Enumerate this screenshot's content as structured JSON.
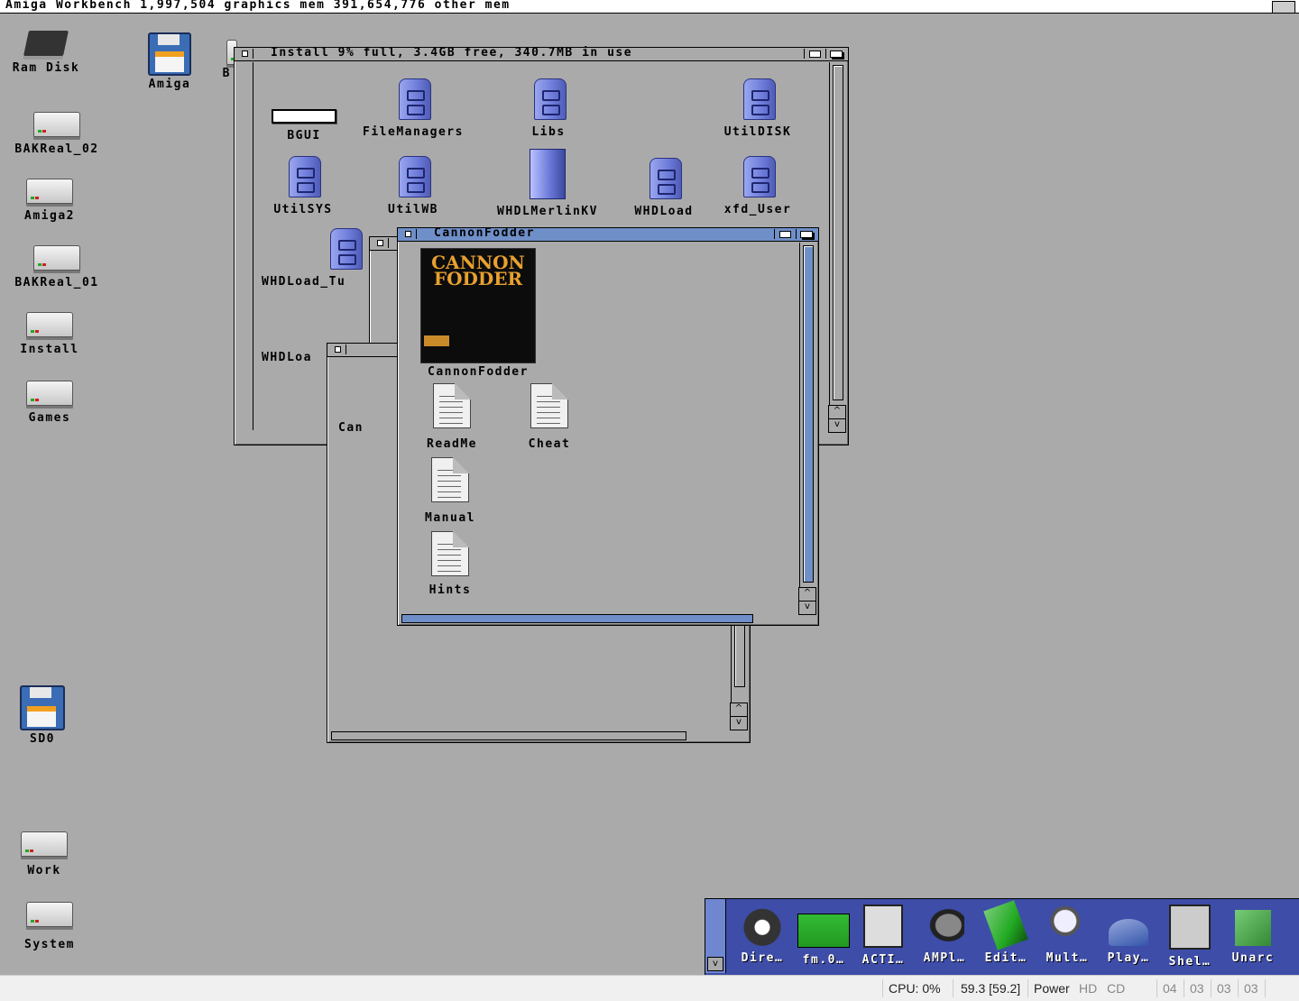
{
  "screen": {
    "title": "Amiga Workbench  1,997,504 graphics mem  391,654,776 other mem"
  },
  "desktop_icons": {
    "ram_disk": "Ram Disk",
    "amiga": "Amiga",
    "b_partial": "B",
    "bakreal02": "BAKReal_02",
    "amiga2": "Amiga2",
    "bakreal01": "BAKReal_01",
    "install": "Install",
    "games": "Games",
    "sd0": "SD0",
    "work": "Work",
    "system": "System"
  },
  "install_window": {
    "title": "Install   9% full, 3.4GB free, 340.7MB in use",
    "icons": {
      "bgui": "BGUI",
      "filemanagers": "FileManagers",
      "libs": "Libs",
      "utildisk": "UtilDISK",
      "utilsys": "UtilSYS",
      "utilwb": "UtilWB",
      "whdlmerlinkv": "WHDLMerlinKV",
      "whdload": "WHDLoad",
      "xfd_user": "xfd_User",
      "whdload_tu": "WHDLoad_Tu",
      "whdloa": "WHDLoa"
    }
  },
  "back_window": {
    "label_partial": "Can"
  },
  "cannon_window": {
    "title": "CannonFodder",
    "cover_line1": "CANNON",
    "cover_line2": "FODDER",
    "icons": {
      "game": "CannonFodder",
      "readme": "ReadMe",
      "cheat": "Cheat",
      "manual": "Manual",
      "hints": "Hints"
    }
  },
  "dock": {
    "items": [
      "Dire…",
      "fm.0…",
      "ACTI…",
      "AMPl…",
      "Edit…",
      "Mult…",
      "Play…",
      "Shel…",
      "Unarc"
    ]
  },
  "statusbar": {
    "cpu": "CPU: 0%",
    "fps": "59.3 [59.2]",
    "power": "Power",
    "hd": "HD",
    "cd": "CD",
    "d0": "04",
    "d1": "03",
    "d2": "03",
    "d3": "03"
  },
  "colors": {
    "desktop": "#aaaaaa",
    "active_title": "#6f8fc8",
    "dock": "#3d4da8"
  }
}
